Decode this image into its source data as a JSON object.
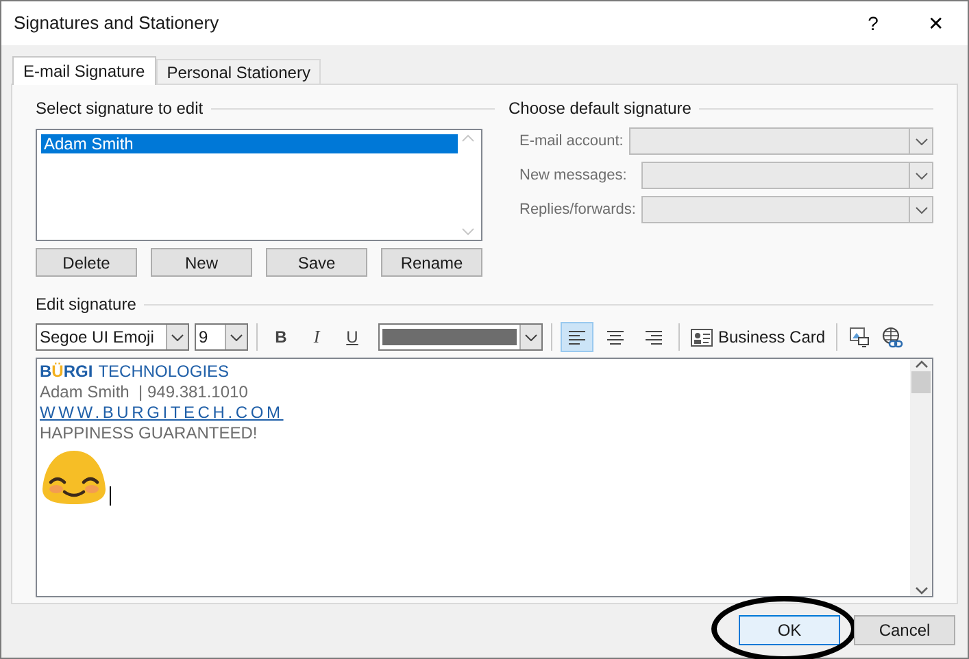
{
  "window": {
    "title": "Signatures and Stationery",
    "buttons": [
      "?",
      "✕"
    ]
  },
  "tabs": [
    {
      "label": "E-mail Signature",
      "selected": true
    },
    {
      "label": "Personal Stationery",
      "selected": false
    }
  ],
  "select_signature": {
    "heading": "Select signature to edit",
    "items": [
      {
        "label": "Adam Smith",
        "selected": true
      }
    ],
    "buttons": [
      "Delete",
      "New",
      "Save",
      "Rename"
    ]
  },
  "default_signature": {
    "heading": "Choose default signature",
    "fields": [
      {
        "label": "E-mail account:",
        "disabled": true
      },
      {
        "label": "New messages:",
        "disabled": true
      },
      {
        "label": "Replies/forwards:",
        "disabled": true
      }
    ]
  },
  "edit_signature": {
    "heading": "Edit signature",
    "toolbar": {
      "font": "Segoe UI Emoji",
      "size": "9",
      "bold": "B",
      "italic": "I",
      "underline": "U",
      "alignment": [
        {
          "kind": "left",
          "selected": true
        },
        {
          "kind": "center",
          "selected": false
        },
        {
          "kind": "right",
          "selected": false
        }
      ],
      "business_card": "Business Card"
    },
    "lines": [
      {
        "kind": "logo",
        "parts": [
          {
            "text": "B",
            "color": "#1f5fa8"
          },
          {
            "text": "Ü",
            "color": "#f2b01e"
          },
          {
            "text": "RGI",
            "color": "#1f5fa8"
          }
        ],
        "text": "TECHNOLOGIES"
      },
      {
        "kind": "plain",
        "text": "Adam Smith  | 949.381.1010"
      },
      {
        "kind": "link",
        "text": "WWW.BURGITECH.COM"
      },
      {
        "kind": "plain",
        "text": "HAPPINESS GUARANTEED!"
      },
      {
        "kind": "emoji"
      }
    ]
  },
  "footer": {
    "buttons": [
      {
        "label": "OK",
        "default": true,
        "circled": true
      },
      {
        "label": "Cancel",
        "default": false,
        "circled": false
      }
    ]
  }
}
